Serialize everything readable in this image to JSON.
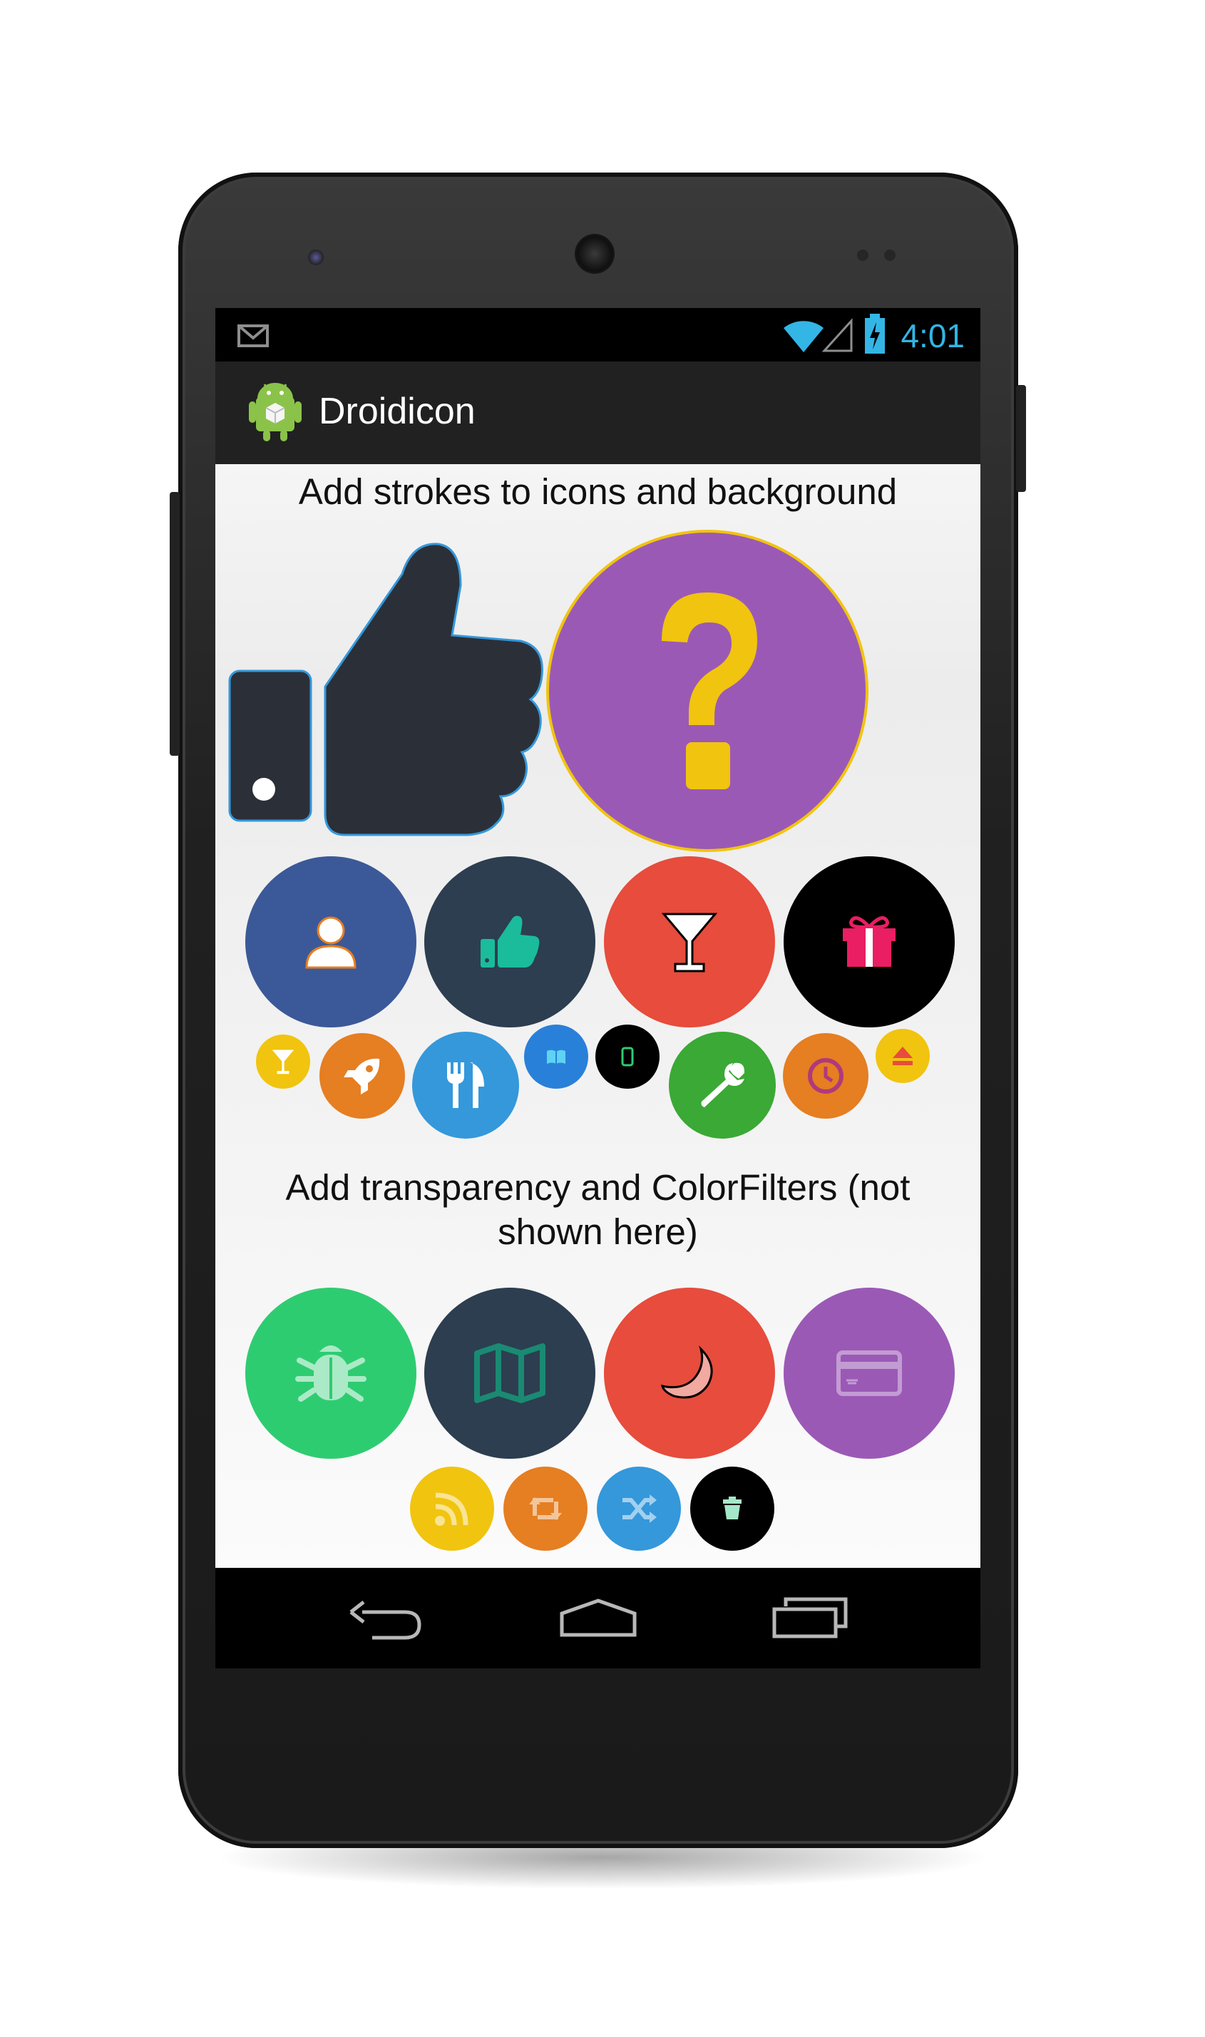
{
  "status_bar": {
    "time": "4:01",
    "notification_icon": "gmail-icon"
  },
  "action_bar": {
    "app_title": "Droidicon",
    "app_icon": "android-app-icon"
  },
  "section1": {
    "heading": "Add strokes to icons and background"
  },
  "section2": {
    "heading_line1": "Add transparency and ColorFilters (not",
    "heading_line2": "shown here)"
  },
  "nav_bar": {
    "back": "back-icon",
    "home": "home-icon",
    "recents": "recents-icon"
  },
  "colors": {
    "blue": "#3b5998",
    "navy": "#2c3e50",
    "red": "#e74c3c",
    "black": "#000000",
    "yellow": "#f1c40f",
    "orange": "#e67e22",
    "sky": "#3498db",
    "green": "#3aa935",
    "emerald": "#2ecc71",
    "purple": "#9b59b6",
    "status_accent": "#33b5e5"
  }
}
